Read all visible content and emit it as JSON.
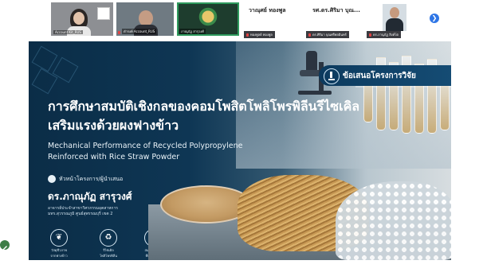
{
  "participants": [
    {
      "name": "Account Kit_RUS",
      "muted": false,
      "style": "woman"
    },
    {
      "name": "ดำรงค์ Account_RUS",
      "muted": true,
      "style": "man"
    },
    {
      "name": "ภาณุภัฏ สารุวงศ์",
      "muted": false,
      "style": "logo",
      "active": true
    }
  ],
  "text_participants": [
    {
      "name": "วาณุศย์ ทองพูล",
      "sub": "ทองพูลย์ ทองพูล",
      "muted": true
    },
    {
      "name": "รศ.ดร.ศิริมา บุณ...",
      "sub": "ดร.ศิริมา บุณศรีพลอินทร์",
      "muted": true
    },
    {
      "name": "",
      "sub": "ดร.ภานุภัฏ สิงห์โต",
      "muted": true
    }
  ],
  "next_button": "❯",
  "slide": {
    "badge": "ข้อเสนอโครงการวิจัย",
    "title_th_1": "การศึกษาสมบัติเชิงกลของคอมโพสิตโพลิโพรพิลีนรีไซเคิล",
    "title_th_2": "เสริมแรงด้วยผงฟางข้าว",
    "title_en_1": "Mechanical Performance of Recycled Polypropylene",
    "title_en_2": "Reinforced with Rice Straw Powder",
    "leader_label": "หัวหน้าโครงการ/ผู้นำเสนอ",
    "presenter": "ดร.ภาณุภัฏ สารุวงศ์",
    "affiliation_1": "อาจารย์ประจำสาขาวิศวกรรมอุตสาหการ",
    "affiliation_2": "มทร.สุวรรณภูมิ ศูนย์สุพรรณบุรี เขต 2",
    "features": [
      {
        "icon": "leaf-icon",
        "glyph": "❦",
        "label_1": "วัสดุชีวภาพ",
        "label_2": "จากฟางข้าว"
      },
      {
        "icon": "recycle-icon",
        "glyph": "♻",
        "label_1": "รีไซเคิล",
        "label_2": "โพลิโพรพิลีน"
      },
      {
        "icon": "gear-icon",
        "glyph": "⚙",
        "label_1": "สมบัติเชิงกล",
        "label_2": "ที่เหนือกว่า"
      }
    ]
  }
}
